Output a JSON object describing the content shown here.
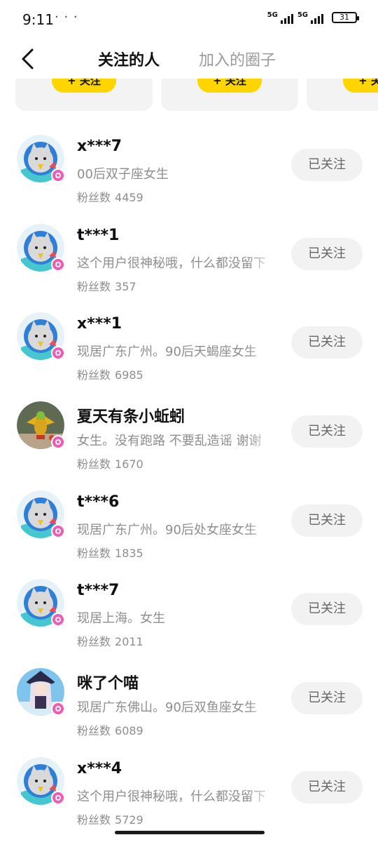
{
  "status_bar": {
    "time": "9:11",
    "dots": "· · ·",
    "network1": "5G",
    "network2": "5G",
    "battery": "31"
  },
  "nav": {
    "tab_following": "关注的人",
    "tab_circles": "加入的圈子"
  },
  "cards": [
    {
      "button": "+ 关注"
    },
    {
      "button": "+ 关注"
    },
    {
      "button": "+ 关注"
    }
  ],
  "colors": {
    "accent_yellow": "#ffd500",
    "badge_pink": "#ee5bb6",
    "secondary_text": "#8e8e8e"
  },
  "users": [
    {
      "name": "x***7",
      "bio": "00后双子座女生",
      "fans_label": "粉丝数",
      "fans": "4459",
      "button": "已关注",
      "avatar": "default-cat-avatar"
    },
    {
      "name": "t***1",
      "bio": "这个用户很神秘哦，什么都没留下",
      "fans_label": "粉丝数",
      "fans": "357",
      "button": "已关注",
      "avatar": "default-cat-avatar"
    },
    {
      "name": "x***1",
      "bio": "现居广东广州。90后天蝎座女生",
      "fans_label": "粉丝数",
      "fans": "6985",
      "button": "已关注",
      "avatar": "default-cat-avatar"
    },
    {
      "name": "夏天有条小蚯蚓",
      "bio": "女生。没有跑路 不要乱造谣 谢谢",
      "fans_label": "粉丝数",
      "fans": "1670",
      "button": "已关注",
      "avatar": "dragon-figure-photo"
    },
    {
      "name": "t***6",
      "bio": "现居广东广州。90后处女座女生",
      "fans_label": "粉丝数",
      "fans": "1835",
      "button": "已关注",
      "avatar": "default-cat-avatar"
    },
    {
      "name": "t***7",
      "bio": "现居上海。女生",
      "fans_label": "粉丝数",
      "fans": "2011",
      "button": "已关注",
      "avatar": "default-cat-avatar"
    },
    {
      "name": "咪了个喵",
      "bio": "现居广东佛山。90后双鱼座女生",
      "fans_label": "粉丝数",
      "fans": "6089",
      "button": "已关注",
      "avatar": "anime-girl-photo"
    },
    {
      "name": "x***4",
      "bio": "这个用户很神秘哦，什么都没留下",
      "fans_label": "粉丝数",
      "fans": "5729",
      "button": "已关注",
      "avatar": "default-cat-avatar"
    }
  ]
}
